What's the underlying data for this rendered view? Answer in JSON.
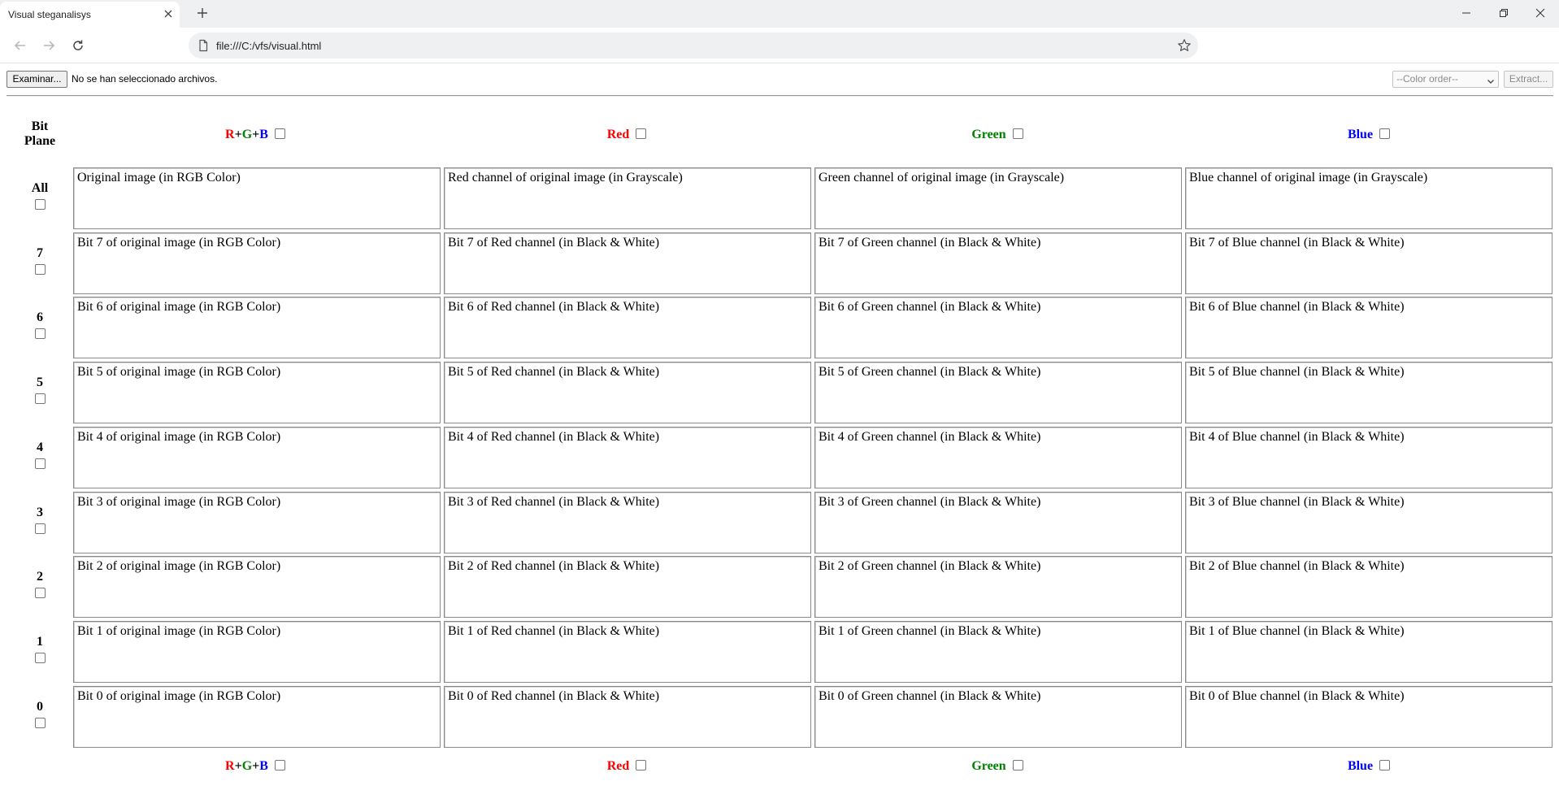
{
  "browser": {
    "tab_title": "Visual steganalisys",
    "url": "file:///C:/vfs/visual.html"
  },
  "controls": {
    "file_button": "Examinar...",
    "file_status": "No se han seleccionado archivos.",
    "color_order_placeholder": "--Color order--",
    "extract_button": "Extract..."
  },
  "grid": {
    "bit_plane_header": [
      "Bit",
      "Plane"
    ],
    "columns": [
      "Original",
      "Red",
      "Green",
      "Blue"
    ],
    "header_red": "Red",
    "header_green": "Green",
    "header_blue": "Blue",
    "rgb_label": {
      "r": "R",
      "plus1": "+",
      "g": "G",
      "plus2": "+",
      "b": "B"
    },
    "rows": [
      {
        "label": "All",
        "cells": [
          "Original image (in RGB Color)",
          "Red channel of original image (in Grayscale)",
          "Green channel of original image (in Grayscale)",
          "Blue channel of original image (in Grayscale)"
        ]
      },
      {
        "label": "7",
        "cells": [
          "Bit 7 of original image (in RGB Color)",
          "Bit 7 of Red channel (in Black & White)",
          "Bit 7 of Green channel (in Black & White)",
          "Bit 7 of Blue channel (in Black & White)"
        ]
      },
      {
        "label": "6",
        "cells": [
          "Bit 6 of original image (in RGB Color)",
          "Bit 6 of Red channel (in Black & White)",
          "Bit 6 of Green channel (in Black & White)",
          "Bit 6 of Blue channel (in Black & White)"
        ]
      },
      {
        "label": "5",
        "cells": [
          "Bit 5 of original image (in RGB Color)",
          "Bit 5 of Red channel (in Black & White)",
          "Bit 5 of Green channel (in Black & White)",
          "Bit 5 of Blue channel (in Black & White)"
        ]
      },
      {
        "label": "4",
        "cells": [
          "Bit 4 of original image (in RGB Color)",
          "Bit 4 of Red channel (in Black & White)",
          "Bit 4 of Green channel (in Black & White)",
          "Bit 4 of Blue channel (in Black & White)"
        ]
      },
      {
        "label": "3",
        "cells": [
          "Bit 3 of original image (in RGB Color)",
          "Bit 3 of Red channel (in Black & White)",
          "Bit 3 of Green channel (in Black & White)",
          "Bit 3 of Blue channel (in Black & White)"
        ]
      },
      {
        "label": "2",
        "cells": [
          "Bit 2 of original image (in RGB Color)",
          "Bit 2 of Red channel (in Black & White)",
          "Bit 2 of Green channel (in Black & White)",
          "Bit 2 of Blue channel (in Black & White)"
        ]
      },
      {
        "label": "1",
        "cells": [
          "Bit 1 of original image (in RGB Color)",
          "Bit 1 of Red channel (in Black & White)",
          "Bit 1 of Green channel (in Black & White)",
          "Bit 1 of Blue channel (in Black & White)"
        ]
      },
      {
        "label": "0",
        "cells": [
          "Bit 0 of original image (in RGB Color)",
          "Bit 0 of Red channel (in Black & White)",
          "Bit 0 of Green channel (in Black & White)",
          "Bit 0 of Blue channel (in Black & White)"
        ]
      }
    ]
  },
  "colors": {
    "red": "#ff0000",
    "green": "#008000",
    "blue": "#0000ff"
  },
  "icons": [
    "close-icon",
    "new-tab-icon",
    "minimize-icon",
    "restore-icon",
    "window-close-icon",
    "back-icon",
    "forward-icon",
    "reload-icon",
    "file-icon",
    "star-icon",
    "chevron-down-icon"
  ]
}
